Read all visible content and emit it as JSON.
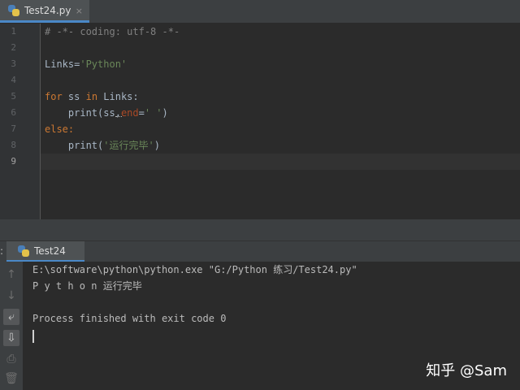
{
  "editor_tab": {
    "label": "Test24.py",
    "close": "×"
  },
  "code_lines": {
    "l1": "# -*- coding: utf-8 -*-",
    "l3_var": "Links=",
    "l3_str": "'Python'",
    "l5_for": "for",
    "l5_mid": " ss ",
    "l5_in": "in",
    "l5_end": " Links:",
    "l6_a": "    print(ss",
    "l6_comma": ",",
    "l6_param": "end",
    "l6_eq": "=",
    "l6_str": "' '",
    "l6_close": ")",
    "l7_else": "else",
    "l7_colon": ":",
    "l8_a": "    print(",
    "l8_str": "'运行完毕'",
    "l8_close": ")"
  },
  "line_numbers": [
    "1",
    "2",
    "3",
    "4",
    "5",
    "6",
    "7",
    "8",
    "9"
  ],
  "run_panel": {
    "colon": ":",
    "tab_label": "Test24"
  },
  "console": {
    "line1": "E:\\software\\python\\python.exe \"G:/Python 练习/Test24.py\"",
    "line2": "P y t h o n 运行完毕",
    "line3": "",
    "line4": "Process finished with exit code 0"
  },
  "sidebar_icons": {
    "up": "↑",
    "down": "↓",
    "wrap": "⤶",
    "scroll": "⇩",
    "print": "⎙",
    "trash": "🗑"
  },
  "watermark": "知乎 @Sam",
  "colors": {
    "accent": "#4a88c7",
    "keyword": "#cc7832",
    "string": "#6a8759",
    "comment": "#808080",
    "parameter": "#aa4926"
  }
}
